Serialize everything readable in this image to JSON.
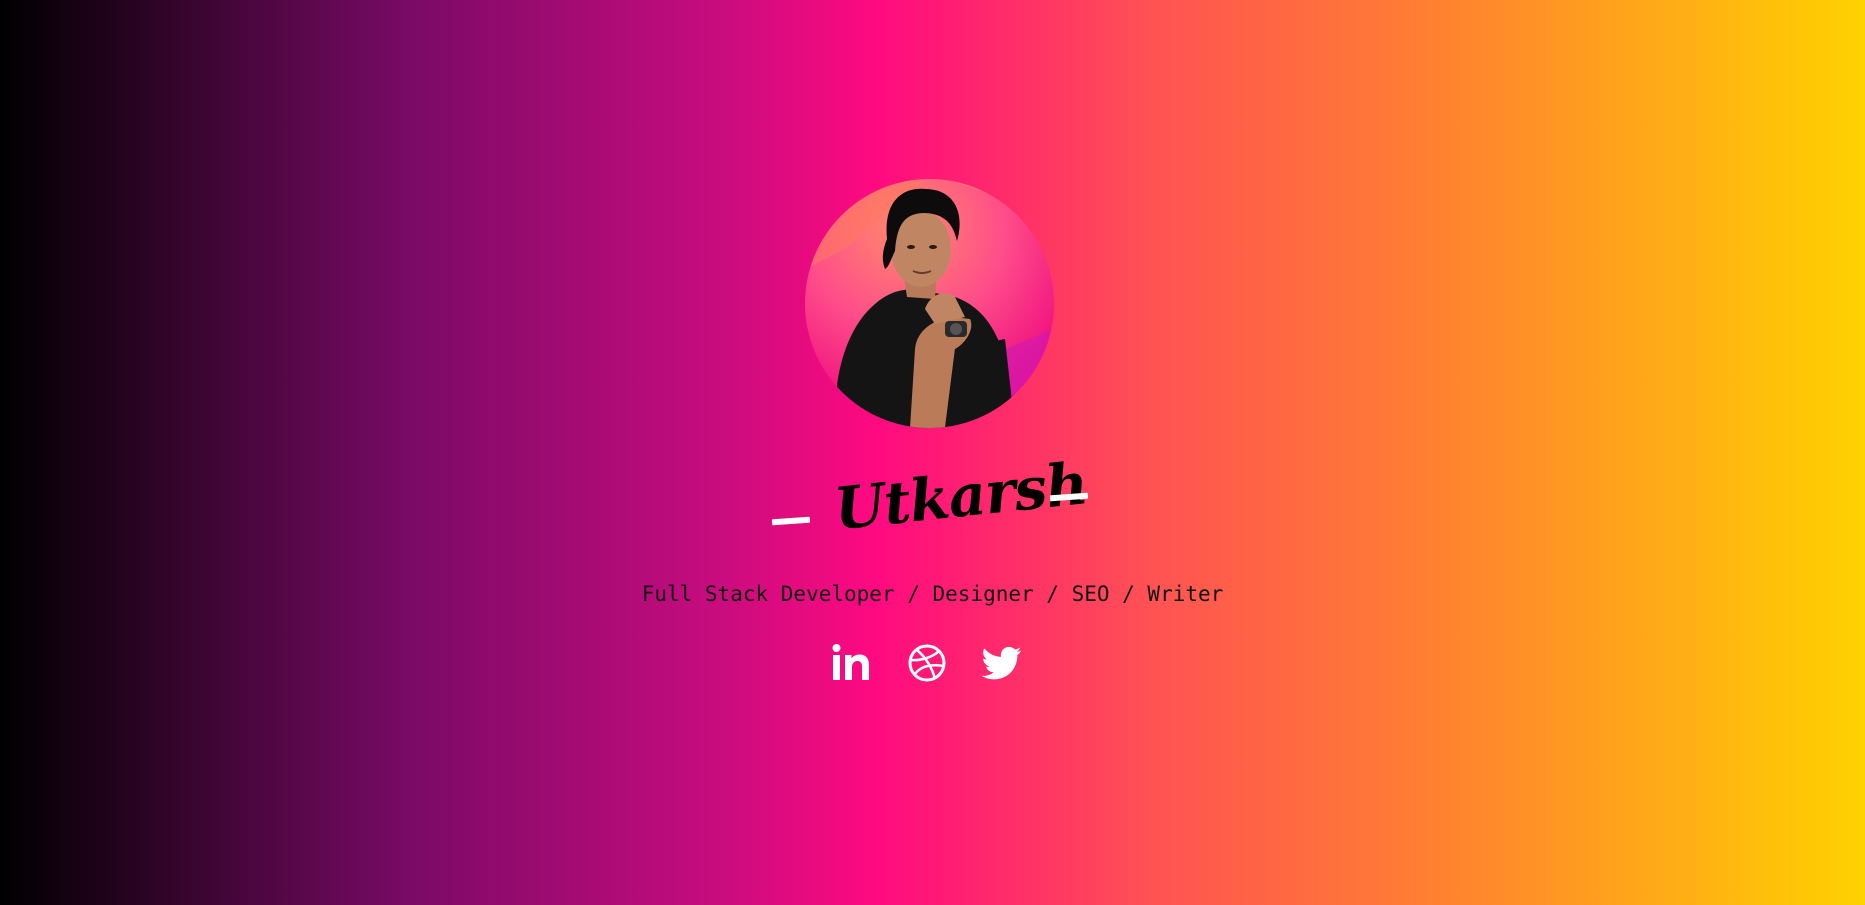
{
  "profile": {
    "name": "Utkarsh",
    "tagline": "Full Stack Developer / Designer / SEO / Writer",
    "avatar_icon": "portrait-photo"
  },
  "socials": [
    {
      "icon": "linkedin-icon",
      "label": "LinkedIn"
    },
    {
      "icon": "dribbble-icon",
      "label": "Dribbble"
    },
    {
      "icon": "twitter-icon",
      "label": "Twitter"
    }
  ],
  "colors": {
    "gradient_start": "#000000",
    "gradient_mid": "#ff0a80",
    "gradient_end": "#ffd200",
    "icon": "#ffffff",
    "text": "#111111"
  }
}
